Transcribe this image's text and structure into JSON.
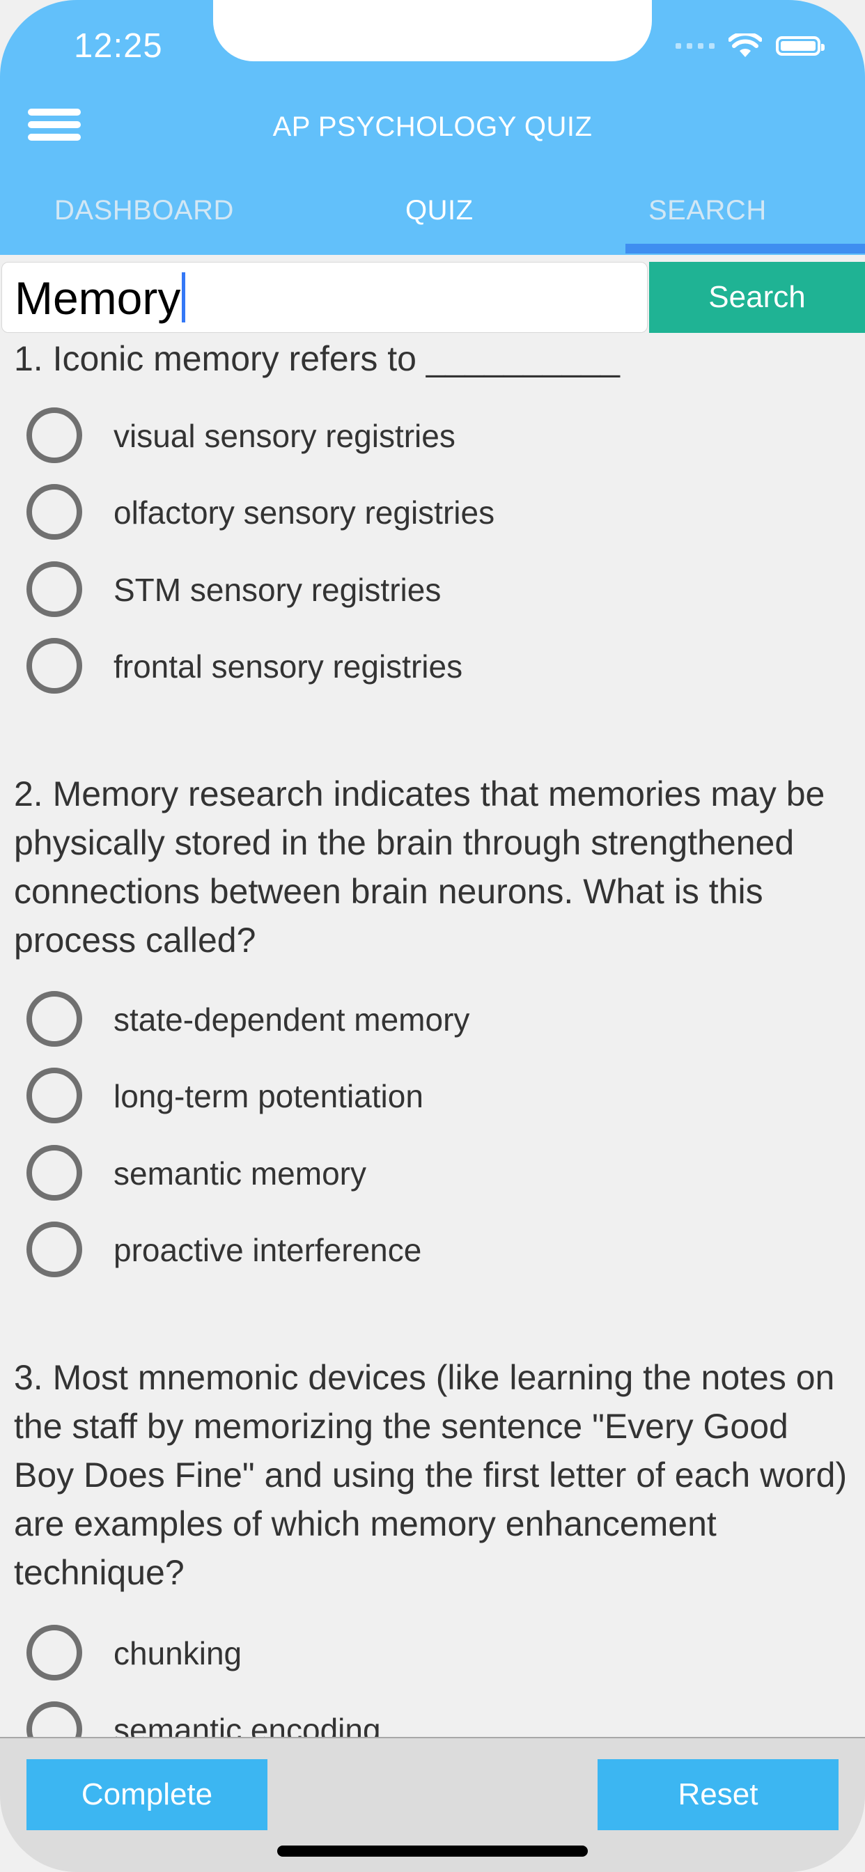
{
  "status_bar": {
    "time": "12:25",
    "icons": [
      "cellular-signal-icon",
      "wifi-icon",
      "battery-icon"
    ]
  },
  "header": {
    "menu_icon": "hamburger-menu-icon",
    "title": "AP PSYCHOLOGY QUIZ"
  },
  "tabs": [
    {
      "label": "DASHBOARD"
    },
    {
      "label": "QUIZ"
    },
    {
      "label": "SEARCH",
      "selected": true
    }
  ],
  "search": {
    "value": "Memory",
    "button_label": "Search"
  },
  "questions": [
    {
      "text": "1. Iconic memory refers to __________",
      "options": [
        "visual sensory registries",
        "olfactory sensory registries",
        "STM sensory registries",
        "frontal sensory registries"
      ]
    },
    {
      "text": "2. Memory research indicates that memories may be physically stored in the brain through strengthened connections between brain neurons. What is this process called?",
      "options": [
        "state-dependent memory",
        "long-term potentiation",
        "semantic memory",
        "proactive interference"
      ]
    },
    {
      "text": "3. Most mnemonic devices (like learning the notes on the staff by memorizing the sentence \"Every Good Boy Does Fine\" and using the first letter of each word) are examples of which memory enhancement technique?",
      "options": [
        "chunking",
        "semantic encoding"
      ]
    }
  ],
  "footer": {
    "complete_label": "Complete",
    "reset_label": "Reset"
  },
  "colors": {
    "header_bg": "#62c0fa",
    "tab_indicator": "#3f8ef0",
    "search_button": "#1fb394",
    "footer_button": "#3cb6f2",
    "content_bg": "#f0f0f0"
  }
}
